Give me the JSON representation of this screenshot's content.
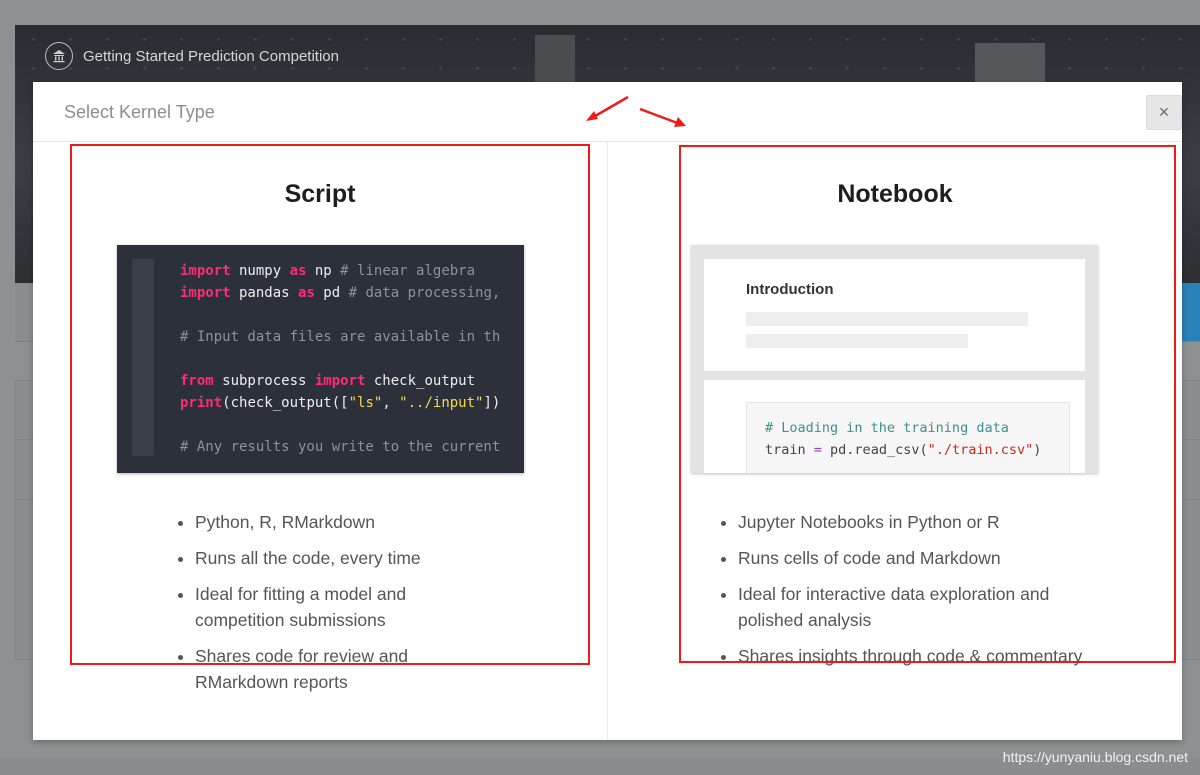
{
  "background": {
    "competition_label": "Getting Started Prediction Competition",
    "watermark": "https://yunyaniu.blog.csdn.net"
  },
  "modal": {
    "title": "Select Kernel Type",
    "close_label": "×"
  },
  "script": {
    "title": "Script",
    "code_lines": [
      [
        {
          "t": "import",
          "c": "kw"
        },
        {
          "t": " numpy "
        },
        {
          "t": "as",
          "c": "kw"
        },
        {
          "t": " np "
        },
        {
          "t": "# linear algebra",
          "c": "cm"
        }
      ],
      [
        {
          "t": "import",
          "c": "kw"
        },
        {
          "t": " pandas "
        },
        {
          "t": "as",
          "c": "kw"
        },
        {
          "t": " pd "
        },
        {
          "t": "# data processing,",
          "c": "cm"
        }
      ],
      [],
      [
        {
          "t": "# Input data files are available in th",
          "c": "cm"
        }
      ],
      [],
      [
        {
          "t": "from",
          "c": "kw"
        },
        {
          "t": " subprocess "
        },
        {
          "t": "import",
          "c": "kw"
        },
        {
          "t": " check_output"
        }
      ],
      [
        {
          "t": "print",
          "c": "kw"
        },
        {
          "t": "(check_output(["
        },
        {
          "t": "\"ls\"",
          "c": "st"
        },
        {
          "t": ", "
        },
        {
          "t": "\"../input\"",
          "c": "st"
        },
        {
          "t": "])"
        }
      ],
      [],
      [
        {
          "t": "# Any results you write to the current",
          "c": "cm"
        }
      ]
    ],
    "features": [
      "Python, R, RMarkdown",
      "Runs all the code, every time",
      "Ideal for fitting a model and competition submissions",
      "Shares code for review and RMarkdown reports"
    ]
  },
  "notebook": {
    "title": "Notebook",
    "intro_heading": "Introduction",
    "code_lines": [
      [
        {
          "t": "# Loading in the training data",
          "c": "nb-cm"
        }
      ],
      [
        {
          "t": "train "
        },
        {
          "t": "=",
          "c": "nb-op"
        },
        {
          "t": " pd.read_csv("
        },
        {
          "t": "\"./train.csv\"",
          "c": "nb-st"
        },
        {
          "t": ")"
        }
      ]
    ],
    "features": [
      "Jupyter Notebooks in Python or R",
      "Runs cells of code and Markdown",
      "Ideal for interactive data exploration and polished analysis",
      "Shares insights through code & commentary"
    ]
  },
  "colors": {
    "annotation_red": "#ee1b1b",
    "code_bg": "#2b303b",
    "keyword": "#ff2d6f",
    "string": "#f7d94c"
  }
}
